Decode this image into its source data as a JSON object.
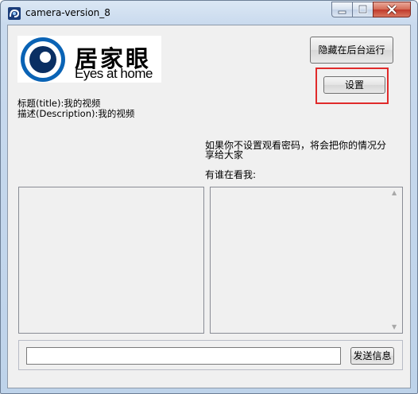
{
  "window": {
    "title": "camera-version_8",
    "controls": {
      "minimize": "─",
      "maximize": "□",
      "close": "✕"
    }
  },
  "logo": {
    "chinese": "居家眼",
    "english": "Eyes at home"
  },
  "buttons": {
    "run_background": "隐藏在后台运行",
    "settings": "设置",
    "send": "发送信息"
  },
  "info": {
    "title_line": "标题(title):我的视频",
    "description_line": "描述(Description):我的视频"
  },
  "notice": "如果你不设置观看密码，将会把你的情况分享给大家",
  "watchers_label": "有谁在看我:",
  "message": {
    "value": "",
    "placeholder": ""
  },
  "highlight_color": "#e02a2a"
}
